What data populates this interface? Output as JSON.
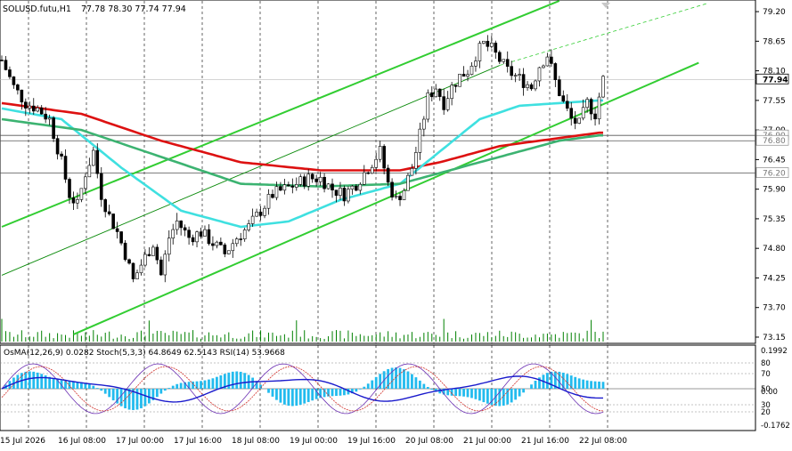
{
  "header": {
    "symbol_label": "SOLUSD.futu,H1",
    "ohlc": "77.78 78.30 77.74 77.94"
  },
  "price_scale": {
    "ticks": [
      "79.20",
      "78.65",
      "78.10",
      "77.55",
      "77.00",
      "76.45",
      "75.90",
      "75.35",
      "74.80",
      "74.25",
      "73.70",
      "73.15"
    ],
    "current_price": "77.94",
    "level_labels": [
      "76.90",
      "76.80",
      "76.20"
    ]
  },
  "osc": {
    "label": "OsMA(12,26,9) 0.0282  Stoch(5,3,3) 64.8649 62.5143  RSI(14) 53.9668",
    "ticks": [
      "0.1992",
      "80",
      "70",
      "50",
      "0.00",
      "30",
      "20",
      "-0.1762"
    ]
  },
  "time_axis": {
    "labels": [
      "15 Jul 2026",
      "16 Jul 08:00",
      "17 Jul 00:00",
      "17 Jul 16:00",
      "18 Jul 08:00",
      "19 Jul 00:00",
      "19 Jul 16:00",
      "20 Jul 08:00",
      "21 Jul 00:00",
      "21 Jul 16:00",
      "22 Jul 08:00"
    ]
  },
  "colors": {
    "bullish": "#008000",
    "channel": "#32cd32",
    "ma_red": "#dd1111",
    "ma_cyan": "#3fe0e0",
    "ma_green": "#3cb371",
    "osma_bar": "#22bbee",
    "rsi_line": "#1a1acc",
    "stoch_main": "#6b2fb3",
    "stoch_signal": "#d0302a"
  },
  "chart_data": {
    "type": "candlestick",
    "symbol": "SOLUSD.futu",
    "timeframe": "H1",
    "ylim": [
      73.1,
      79.35
    ],
    "close_path": [
      [
        0,
        78.3
      ],
      [
        3,
        77.8
      ],
      [
        6,
        77.5
      ],
      [
        9,
        77.4
      ],
      [
        12,
        77.2
      ],
      [
        15,
        76.4
      ],
      [
        17,
        75.8
      ],
      [
        19,
        75.6
      ],
      [
        21,
        76.2
      ],
      [
        23,
        76.6
      ],
      [
        25,
        75.8
      ],
      [
        27,
        75.4
      ],
      [
        29,
        75.1
      ],
      [
        31,
        74.7
      ],
      [
        33,
        74.2
      ],
      [
        35,
        74.5
      ],
      [
        38,
        74.9
      ],
      [
        40,
        74.3
      ],
      [
        42,
        75.0
      ],
      [
        44,
        75.3
      ],
      [
        47,
        75.0
      ],
      [
        50,
        75.1
      ],
      [
        53,
        74.9
      ],
      [
        56,
        74.7
      ],
      [
        59,
        75.0
      ],
      [
        62,
        75.2
      ],
      [
        65,
        75.5
      ],
      [
        68,
        75.8
      ],
      [
        71,
        75.9
      ],
      [
        74,
        76.0
      ],
      [
        77,
        76.1
      ],
      [
        80,
        76.1
      ],
      [
        83,
        75.9
      ],
      [
        86,
        75.8
      ],
      [
        89,
        76.0
      ],
      [
        92,
        76.3
      ],
      [
        95,
        76.6
      ],
      [
        97,
        76.0
      ],
      [
        99,
        75.7
      ],
      [
        101,
        75.9
      ],
      [
        103,
        76.3
      ],
      [
        105,
        76.9
      ],
      [
        107,
        77.6
      ],
      [
        109,
        77.8
      ],
      [
        111,
        77.5
      ],
      [
        113,
        77.8
      ],
      [
        115,
        78.0
      ],
      [
        117,
        78.1
      ],
      [
        119,
        78.4
      ],
      [
        121,
        78.6
      ],
      [
        123,
        78.5
      ],
      [
        125,
        78.3
      ],
      [
        127,
        78.1
      ],
      [
        129,
        78.0
      ],
      [
        131,
        77.9
      ],
      [
        133,
        77.8
      ],
      [
        135,
        78.2
      ],
      [
        137,
        78.4
      ],
      [
        139,
        77.9
      ],
      [
        141,
        77.5
      ],
      [
        143,
        77.2
      ],
      [
        145,
        77.1
      ],
      [
        147,
        77.5
      ],
      [
        149,
        77.3
      ],
      [
        151,
        77.94
      ]
    ],
    "moving_averages": [
      {
        "name": "red",
        "points": [
          [
            0,
            77.5
          ],
          [
            20,
            77.3
          ],
          [
            40,
            76.8
          ],
          [
            60,
            76.4
          ],
          [
            80,
            76.25
          ],
          [
            100,
            76.25
          ],
          [
            110,
            76.4
          ],
          [
            125,
            76.7
          ],
          [
            140,
            76.85
          ],
          [
            150,
            76.95
          ]
        ]
      },
      {
        "name": "cyan",
        "points": [
          [
            0,
            77.4
          ],
          [
            15,
            77.2
          ],
          [
            30,
            76.3
          ],
          [
            45,
            75.5
          ],
          [
            60,
            75.2
          ],
          [
            72,
            75.3
          ],
          [
            85,
            75.7
          ],
          [
            100,
            76.0
          ],
          [
            110,
            76.6
          ],
          [
            120,
            77.2
          ],
          [
            130,
            77.45
          ],
          [
            140,
            77.5
          ],
          [
            150,
            77.55
          ]
        ]
      },
      {
        "name": "green",
        "points": [
          [
            0,
            77.2
          ],
          [
            20,
            77.0
          ],
          [
            40,
            76.5
          ],
          [
            60,
            76.0
          ],
          [
            80,
            75.95
          ],
          [
            100,
            76.0
          ],
          [
            110,
            76.2
          ],
          [
            125,
            76.5
          ],
          [
            140,
            76.8
          ],
          [
            150,
            76.9
          ]
        ]
      }
    ],
    "channels": [
      {
        "name": "upper-channel",
        "points": [
          [
            0,
            75.2
          ],
          [
            140,
            79.4
          ]
        ]
      },
      {
        "name": "lower-channel",
        "points": [
          [
            18,
            73.2
          ],
          [
            175,
            78.25
          ]
        ]
      },
      {
        "name": "mid-channel-thin",
        "points": [
          [
            0,
            74.3
          ],
          [
            125,
            78.2
          ]
        ]
      }
    ],
    "horizontal_levels": [
      76.9,
      76.8,
      76.2
    ]
  }
}
